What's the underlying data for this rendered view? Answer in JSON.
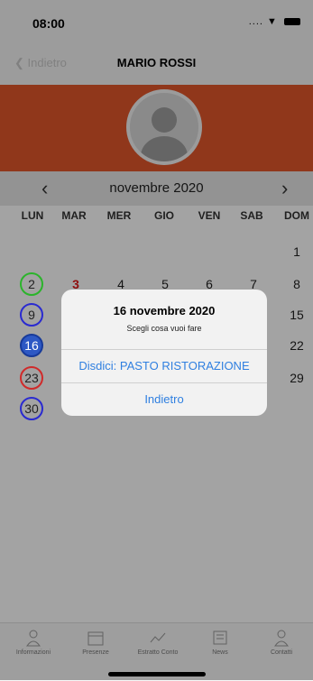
{
  "status": {
    "time": "08:00",
    "signal": "...."
  },
  "nav": {
    "back_label": "Indietro",
    "title": "MARIO ROSSI"
  },
  "calendar": {
    "month_label": "novembre 2020",
    "weekdays": [
      "LUN",
      "MAR",
      "MER",
      "GIO",
      "VEN",
      "SAB",
      "DOM"
    ],
    "days": {
      "d1": "1",
      "d2": "2",
      "d3": "3",
      "d4": "4",
      "d5": "5",
      "d6": "6",
      "d7": "7",
      "d8": "8",
      "d9": "9",
      "d15": "15",
      "d16": "16",
      "d22": "22",
      "d23": "23",
      "d29": "29",
      "d30": "30"
    }
  },
  "alert": {
    "title": "16 novembre 2020",
    "message": "Scegli cosa vuoi fare",
    "action_cancel_meal": "Disdici: PASTO RISTORAZIONE",
    "action_back": "Indietro"
  },
  "tabs": [
    "Informazioni",
    "Presenze",
    "Estratto Conto",
    "News",
    "Contatti"
  ],
  "colors": {
    "banner": "#e2562b",
    "link": "#2f7fe0",
    "today_fill": "#2d58c4"
  }
}
